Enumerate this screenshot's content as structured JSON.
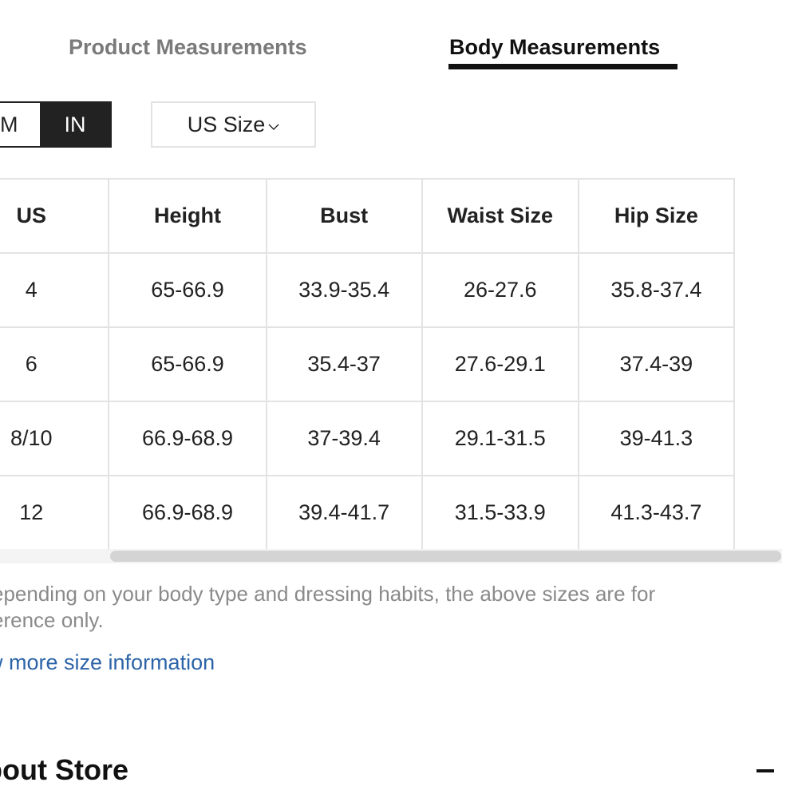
{
  "tabs": {
    "product": "Product Measurements",
    "body": "Body Measurements"
  },
  "units": {
    "cm_label": "M",
    "in_label": "IN",
    "selected": "IN"
  },
  "size_select": {
    "value": "US Size"
  },
  "table": {
    "headers": [
      "US",
      "Height",
      "Bust",
      "Waist Size",
      "Hip Size"
    ],
    "rows": [
      [
        "4",
        "65-66.9",
        "33.9-35.4",
        "26-27.6",
        "35.8-37.4"
      ],
      [
        "6",
        "65-66.9",
        "35.4-37",
        "27.6-29.1",
        "37.4-39"
      ],
      [
        "8/10",
        "66.9-68.9",
        "37-39.4",
        "29.1-31.5",
        "39-41.3"
      ],
      [
        "12",
        "66.9-68.9",
        "39.4-41.7",
        "31.5-33.9",
        "41.3-43.7"
      ]
    ]
  },
  "note": {
    "line1": "epending on your body type and dressing habits, the above sizes are for",
    "line2": "erence only."
  },
  "link": "w more size information",
  "about_store": {
    "title": "bout Store",
    "collapse_icon": "minus-icon"
  }
}
